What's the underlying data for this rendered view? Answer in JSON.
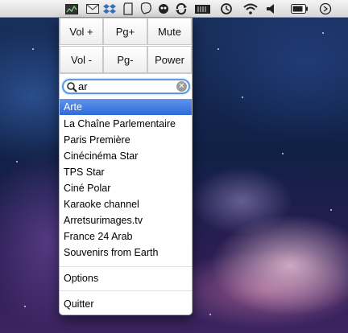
{
  "menubar": {
    "icons": [
      "activity-monitor-icon",
      "mail-icon",
      "dropbox-icon",
      "evernote-icon",
      "chat-bubble-icon",
      "tv-remote-icon",
      "sync-icon",
      "battery-indicator-icon",
      "time-machine-icon",
      "wifi-icon",
      "volume-icon",
      "battery-icon",
      "clock-icon"
    ]
  },
  "remote": {
    "buttons": [
      {
        "label": "Vol +"
      },
      {
        "label": "Pg+"
      },
      {
        "label": "Mute"
      },
      {
        "label": "Vol -"
      },
      {
        "label": "Pg-"
      },
      {
        "label": "Power"
      }
    ]
  },
  "search": {
    "value": "ar"
  },
  "channels": [
    {
      "label": "Arte",
      "selected": true
    },
    {
      "label": "La Chaîne Parlementaire",
      "selected": false
    },
    {
      "label": "Paris Première",
      "selected": false
    },
    {
      "label": "Cinécinéma Star",
      "selected": false
    },
    {
      "label": "TPS Star",
      "selected": false
    },
    {
      "label": "Ciné Polar",
      "selected": false
    },
    {
      "label": "Karaoke channel",
      "selected": false
    },
    {
      "label": "Arretsurimages.tv",
      "selected": false
    },
    {
      "label": "France 24 Arab",
      "selected": false
    },
    {
      "label": "Souvenirs from Earth",
      "selected": false
    }
  ],
  "menu": {
    "options_label": "Options",
    "quit_label": "Quitter"
  },
  "colors": {
    "selection": "#3b78e0",
    "search_focus": "#5a9ae0"
  }
}
